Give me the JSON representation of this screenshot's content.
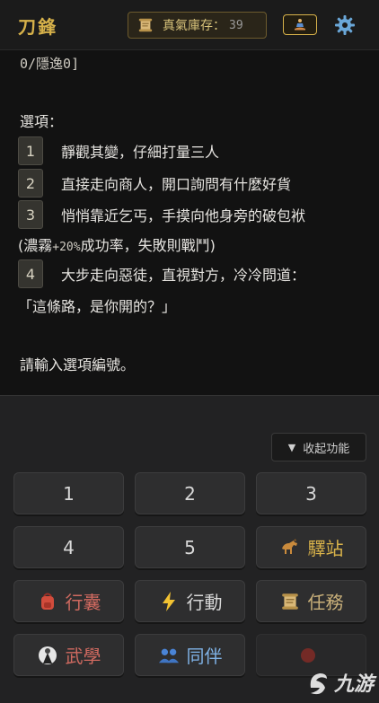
{
  "header": {
    "title": "刀鋒",
    "qi_label": "真氣庫存：",
    "qi_value": "39",
    "icons": [
      "scroll-icon",
      "meditate-icon",
      "gear-icon"
    ]
  },
  "story": {
    "carryover": "0/隱逸0]",
    "options_heading": "選項：",
    "options": [
      {
        "num": "1",
        "text": "靜觀其變，仔細打量三人"
      },
      {
        "num": "2",
        "text": "直接走向商人，開口詢問有什麼好貨"
      },
      {
        "num": "3",
        "text": "悄悄靠近乞丐，手摸向他身旁的破包袱"
      },
      {
        "num": "4",
        "text": "大步走向惡徒，直視對方，冷冷問道："
      }
    ],
    "opt3_cont_pre": "(濃霧",
    "opt3_cont_pct": "+20%",
    "opt3_cont_post": "成功率，失敗則戰鬥)",
    "opt4_cont": "「這條路，是你開的？」",
    "prompt": "請輸入選項編號。"
  },
  "panel": {
    "collapse_label": "收起功能",
    "collapse_icon": "triangle-down-icon",
    "keys": [
      {
        "label": "1"
      },
      {
        "label": "2"
      },
      {
        "label": "3"
      },
      {
        "label": "4"
      },
      {
        "label": "5"
      },
      {
        "label": "驛站",
        "icon": "horse-icon"
      },
      {
        "label": "行囊",
        "icon": "backpack-icon"
      },
      {
        "label": "行動",
        "icon": "lightning-icon"
      },
      {
        "label": "任務",
        "icon": "scroll-icon"
      },
      {
        "label": "武學",
        "icon": "martial-arts-icon"
      },
      {
        "label": "同伴",
        "icon": "companions-icon"
      }
    ],
    "watermark_text": "九游"
  },
  "colors": {
    "accent_gold": "#d6b14a",
    "background": "#121212",
    "panel": "#222223",
    "button": "#2e2e2f",
    "red_label": "#d06a60",
    "blue_label": "#7fb2e6"
  }
}
